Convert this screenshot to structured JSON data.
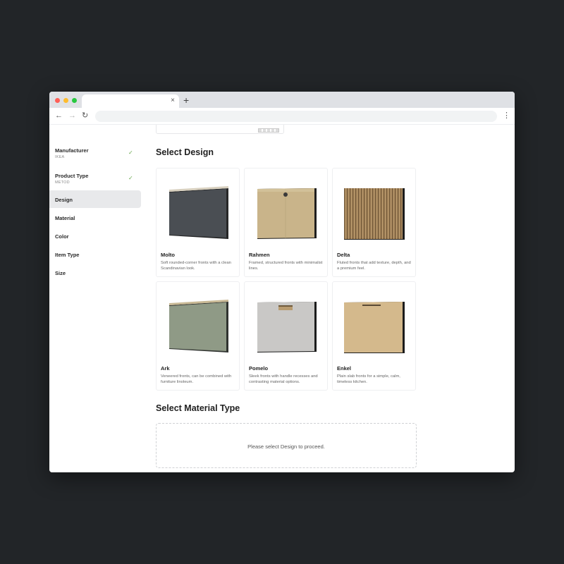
{
  "browser": {
    "tab_close": "×",
    "new_tab": "+",
    "back": "←",
    "forward": "→",
    "reload": "↻",
    "menu": "⋮"
  },
  "sidebar": {
    "items": [
      {
        "label": "Manufacturer",
        "sub": "IKEA",
        "done": true
      },
      {
        "label": "Product Type",
        "sub": "METOD",
        "done": true
      },
      {
        "label": "Design",
        "active": true
      },
      {
        "label": "Material"
      },
      {
        "label": "Color"
      },
      {
        "label": "Item Type"
      },
      {
        "label": "Size"
      }
    ],
    "check_glyph": "✓"
  },
  "main": {
    "design_title": "Select Design",
    "designs": [
      {
        "name": "Molto",
        "desc": "Soft rounded-corner fronts with a clean Scandinavian look.",
        "color": "#4a4e53"
      },
      {
        "name": "Rahmen",
        "desc": "Framed, structured fronts with minimalist lines.",
        "color": "#c9b48a"
      },
      {
        "name": "Delta",
        "desc": "Fluted fronts that add texture, depth, and a premium feel.",
        "color": "#9e7f55"
      },
      {
        "name": "Ark",
        "desc": "Veneered fronts, can be combined with furniture linoleum.",
        "color": "#8f9a86"
      },
      {
        "name": "Pomelo",
        "desc": "Sleek fronts with handle recesses and contrasting material options.",
        "color": "#c9c8c6"
      },
      {
        "name": "Enkel",
        "desc": "Plain slab fronts for a simple, calm, timeless kitchen.",
        "color": "#d4b98c"
      }
    ],
    "material_title": "Select Material Type",
    "material_notice": "Please select Design to proceed."
  }
}
